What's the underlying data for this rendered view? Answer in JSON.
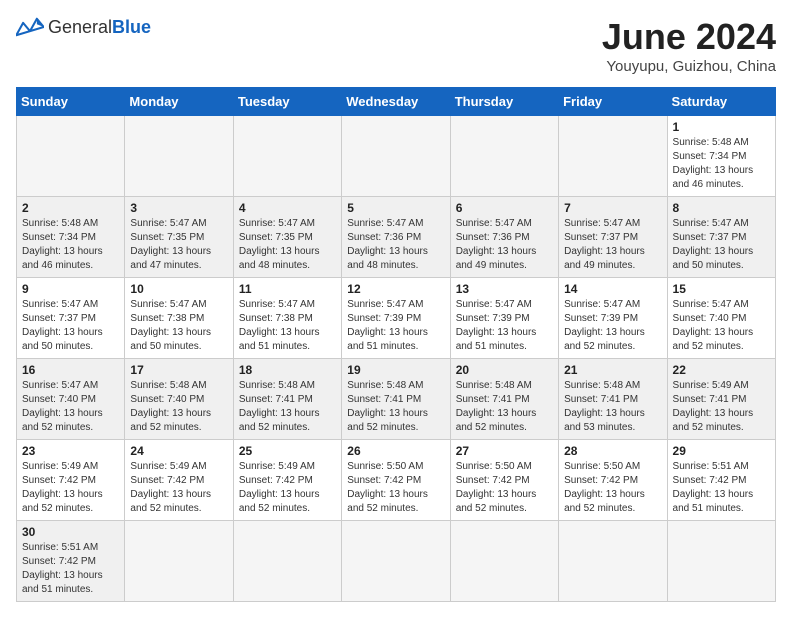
{
  "header": {
    "logo_general": "General",
    "logo_blue": "Blue",
    "month_title": "June 2024",
    "subtitle": "Youyupu, Guizhou, China"
  },
  "weekdays": [
    "Sunday",
    "Monday",
    "Tuesday",
    "Wednesday",
    "Thursday",
    "Friday",
    "Saturday"
  ],
  "weeks": [
    [
      {
        "day": "",
        "info": ""
      },
      {
        "day": "",
        "info": ""
      },
      {
        "day": "",
        "info": ""
      },
      {
        "day": "",
        "info": ""
      },
      {
        "day": "",
        "info": ""
      },
      {
        "day": "",
        "info": ""
      },
      {
        "day": "1",
        "info": "Sunrise: 5:48 AM\nSunset: 7:34 PM\nDaylight: 13 hours and 46 minutes."
      }
    ],
    [
      {
        "day": "2",
        "info": "Sunrise: 5:48 AM\nSunset: 7:34 PM\nDaylight: 13 hours and 46 minutes."
      },
      {
        "day": "3",
        "info": "Sunrise: 5:47 AM\nSunset: 7:35 PM\nDaylight: 13 hours and 47 minutes."
      },
      {
        "day": "4",
        "info": "Sunrise: 5:47 AM\nSunset: 7:35 PM\nDaylight: 13 hours and 48 minutes."
      },
      {
        "day": "5",
        "info": "Sunrise: 5:47 AM\nSunset: 7:36 PM\nDaylight: 13 hours and 48 minutes."
      },
      {
        "day": "6",
        "info": "Sunrise: 5:47 AM\nSunset: 7:36 PM\nDaylight: 13 hours and 49 minutes."
      },
      {
        "day": "7",
        "info": "Sunrise: 5:47 AM\nSunset: 7:37 PM\nDaylight: 13 hours and 49 minutes."
      },
      {
        "day": "8",
        "info": "Sunrise: 5:47 AM\nSunset: 7:37 PM\nDaylight: 13 hours and 50 minutes."
      }
    ],
    [
      {
        "day": "9",
        "info": "Sunrise: 5:47 AM\nSunset: 7:37 PM\nDaylight: 13 hours and 50 minutes."
      },
      {
        "day": "10",
        "info": "Sunrise: 5:47 AM\nSunset: 7:38 PM\nDaylight: 13 hours and 50 minutes."
      },
      {
        "day": "11",
        "info": "Sunrise: 5:47 AM\nSunset: 7:38 PM\nDaylight: 13 hours and 51 minutes."
      },
      {
        "day": "12",
        "info": "Sunrise: 5:47 AM\nSunset: 7:39 PM\nDaylight: 13 hours and 51 minutes."
      },
      {
        "day": "13",
        "info": "Sunrise: 5:47 AM\nSunset: 7:39 PM\nDaylight: 13 hours and 51 minutes."
      },
      {
        "day": "14",
        "info": "Sunrise: 5:47 AM\nSunset: 7:39 PM\nDaylight: 13 hours and 52 minutes."
      },
      {
        "day": "15",
        "info": "Sunrise: 5:47 AM\nSunset: 7:40 PM\nDaylight: 13 hours and 52 minutes."
      }
    ],
    [
      {
        "day": "16",
        "info": "Sunrise: 5:47 AM\nSunset: 7:40 PM\nDaylight: 13 hours and 52 minutes."
      },
      {
        "day": "17",
        "info": "Sunrise: 5:48 AM\nSunset: 7:40 PM\nDaylight: 13 hours and 52 minutes."
      },
      {
        "day": "18",
        "info": "Sunrise: 5:48 AM\nSunset: 7:41 PM\nDaylight: 13 hours and 52 minutes."
      },
      {
        "day": "19",
        "info": "Sunrise: 5:48 AM\nSunset: 7:41 PM\nDaylight: 13 hours and 52 minutes."
      },
      {
        "day": "20",
        "info": "Sunrise: 5:48 AM\nSunset: 7:41 PM\nDaylight: 13 hours and 52 minutes."
      },
      {
        "day": "21",
        "info": "Sunrise: 5:48 AM\nSunset: 7:41 PM\nDaylight: 13 hours and 53 minutes."
      },
      {
        "day": "22",
        "info": "Sunrise: 5:49 AM\nSunset: 7:41 PM\nDaylight: 13 hours and 52 minutes."
      }
    ],
    [
      {
        "day": "23",
        "info": "Sunrise: 5:49 AM\nSunset: 7:42 PM\nDaylight: 13 hours and 52 minutes."
      },
      {
        "day": "24",
        "info": "Sunrise: 5:49 AM\nSunset: 7:42 PM\nDaylight: 13 hours and 52 minutes."
      },
      {
        "day": "25",
        "info": "Sunrise: 5:49 AM\nSunset: 7:42 PM\nDaylight: 13 hours and 52 minutes."
      },
      {
        "day": "26",
        "info": "Sunrise: 5:50 AM\nSunset: 7:42 PM\nDaylight: 13 hours and 52 minutes."
      },
      {
        "day": "27",
        "info": "Sunrise: 5:50 AM\nSunset: 7:42 PM\nDaylight: 13 hours and 52 minutes."
      },
      {
        "day": "28",
        "info": "Sunrise: 5:50 AM\nSunset: 7:42 PM\nDaylight: 13 hours and 52 minutes."
      },
      {
        "day": "29",
        "info": "Sunrise: 5:51 AM\nSunset: 7:42 PM\nDaylight: 13 hours and 51 minutes."
      }
    ],
    [
      {
        "day": "30",
        "info": "Sunrise: 5:51 AM\nSunset: 7:42 PM\nDaylight: 13 hours and 51 minutes."
      },
      {
        "day": "",
        "info": ""
      },
      {
        "day": "",
        "info": ""
      },
      {
        "day": "",
        "info": ""
      },
      {
        "day": "",
        "info": ""
      },
      {
        "day": "",
        "info": ""
      },
      {
        "day": "",
        "info": ""
      }
    ]
  ]
}
